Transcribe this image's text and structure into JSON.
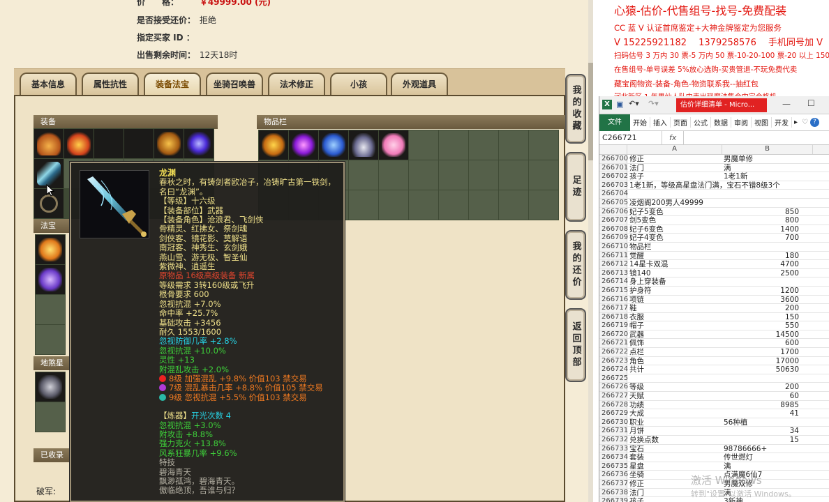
{
  "trade_info": {
    "price_label": "价　　格：",
    "price_value": "￥49999.00 (元)",
    "counter_label": "是否接受还价：",
    "counter_value": "拒绝",
    "buyer_label": "指定买家 ID ：",
    "buyer_value": "",
    "remain_label": "出售剩余时间：",
    "remain_value": "12天18时"
  },
  "tabs": [
    "基本信息",
    "属性抗性",
    "装备法宝",
    "坐骑召唤兽",
    "法术修正",
    "小孩",
    "外观道具"
  ],
  "active_tab": "装备法宝",
  "sections": {
    "equip": "装备",
    "inventory": "物品栏",
    "treasure": "法宝",
    "earth_treasure": "地煞星阵",
    "collected": "已收录",
    "break_label": "破军:"
  },
  "side_buttons": [
    "我的收藏",
    "足迹",
    "我的还价",
    "返回顶部"
  ],
  "tooltip": {
    "name": "龙渊",
    "desc": "春秋之时，有铸剑者欧冶子，冶铸旷古第一铁剑，名曰“龙渊”。",
    "level": "【等级】十六级",
    "slot": "【装备部位】武器",
    "roles": "【装备角色】沧浪君、飞剑侠",
    "roles2": "骨精灵、红拂女、祭剑魂",
    "roles3": "剑侠客、镜花影、莫解语",
    "roles4": "南冠客、神秀生、玄剑娥",
    "roles5": "燕山雪、游无极、智圣仙",
    "roles6": "紫微神、逍遥生",
    "origin": "原物品 16级高级装备 新属",
    "req_level": "等级需求 3转160级或飞升",
    "req_bone": "根骨要求 600",
    "attr1": "忽视抗混 +7.0%",
    "attr2": "命中率 +25.7%",
    "attr3": "基础攻击 +3456",
    "durability": "耐久 1553/1600",
    "attr4": "忽视防御几率 +2.8%",
    "attr5": "忽视抗混 +10.0%",
    "attr6": "灵性 +13",
    "attr7": "附混乱攻击 +2.0%",
    "gem1": "8级 加强混乱 +9.8% 价值103 禁交易",
    "gem2": "7级 混乱暴击几率 +8.8% 价值105 禁交易",
    "gem3": "9级 忽视抗混 +5.5% 价值103 禁交易",
    "refine_head": "【炼器】",
    "refine_count": "开光次数 4",
    "ref1": "忽视抗混 +3.0%",
    "ref2": "附攻击 +8.8%",
    "ref3": "强力克火 +13.8%",
    "ref4": "风系狂暴几率 +9.6%",
    "skill_head": "特技",
    "skill_name": "碧海青天",
    "skill_desc": "飘渺孤鸿，碧海青天。",
    "skill_desc2": "傲临绝顶，吾谁与归？"
  },
  "promo": {
    "line1": "心猿-估价-代售组号-找号-免费配装",
    "line2": "CC 蓝 V 认证首席鉴定+大神金牌鉴定为您服务",
    "line3": "V 15225921182 　1379258576 　手机同号加 V",
    "line4": "扫码估号 3 万内 30 票-5 万内 50 票-10-20-100 票-20 以上 150",
    "line5": "在售组号-单号误差 5%放心选购-买贵管退-不玩免费代卖",
    "line6": "藏宝阁物资-装备-角色-物资联系我--抽红包",
    "line7": "河北新区 1 年男仙人队中表出现魔法集合中宗合格机"
  },
  "excel": {
    "window_title": "估价详细清单 - Micro...",
    "file_tab": "文件",
    "menus": [
      "开始",
      "插入",
      "页面",
      "公式",
      "数据",
      "审阅",
      "视图",
      "开发"
    ],
    "name_box": "C266721",
    "fx": "fx",
    "col_a": "A",
    "col_b": "B",
    "rows": [
      {
        "n": "266700",
        "a": "修正",
        "b": "男魔单修",
        "t": "txt"
      },
      {
        "n": "266701",
        "a": "法门",
        "b": "满",
        "t": "txt"
      },
      {
        "n": "266702",
        "a": "孩子",
        "b": "1老1新",
        "t": "txt"
      },
      {
        "n": "266703",
        "a": "1老1新，等级高星盘法门满，宝石不错8级3个",
        "b": "",
        "t": "txt"
      },
      {
        "n": "266704",
        "a": "",
        "b": "",
        "t": "txt"
      },
      {
        "n": "266705",
        "a": "凌烟阁200男人49999",
        "b": "",
        "t": "txt"
      },
      {
        "n": "266706",
        "a": "妃子5变色",
        "b": "850",
        "t": "num"
      },
      {
        "n": "266707",
        "a": "剑5变色",
        "b": "800",
        "t": "num"
      },
      {
        "n": "266708",
        "a": "妃子6变色",
        "b": "1400",
        "t": "num"
      },
      {
        "n": "266709",
        "a": "妃子4变色",
        "b": "700",
        "t": "num"
      },
      {
        "n": "266710",
        "a": "物品栏",
        "b": "",
        "t": "txt"
      },
      {
        "n": "266711",
        "a": "觉醒",
        "b": "180",
        "t": "num"
      },
      {
        "n": "266712",
        "a": "14星卡双混",
        "b": "4700",
        "t": "num"
      },
      {
        "n": "266713",
        "a": "镜140",
        "b": "2500",
        "t": "num"
      },
      {
        "n": "266714",
        "a": "身上穿装备",
        "b": "",
        "t": "txt"
      },
      {
        "n": "266715",
        "a": "护身符",
        "b": "1200",
        "t": "num"
      },
      {
        "n": "266716",
        "a": "项链",
        "b": "3600",
        "t": "num"
      },
      {
        "n": "266717",
        "a": "鞋",
        "b": "200",
        "t": "num"
      },
      {
        "n": "266718",
        "a": "衣服",
        "b": "150",
        "t": "num"
      },
      {
        "n": "266719",
        "a": "帽子",
        "b": "550",
        "t": "num"
      },
      {
        "n": "266720",
        "a": "武器",
        "b": "14500",
        "t": "num"
      },
      {
        "n": "266721",
        "a": "佩饰",
        "b": "600",
        "t": "num"
      },
      {
        "n": "266722",
        "a": "点栏",
        "b": "1700",
        "t": "num"
      },
      {
        "n": "266723",
        "a": "角色",
        "b": "17000",
        "t": "num"
      },
      {
        "n": "266724",
        "a": "共计",
        "b": "50630",
        "t": "num"
      },
      {
        "n": "266725",
        "a": "",
        "b": "",
        "t": "txt"
      },
      {
        "n": "266726",
        "a": "等级",
        "b": "200",
        "t": "num"
      },
      {
        "n": "266727",
        "a": "天赋",
        "b": "60",
        "t": "num"
      },
      {
        "n": "266728",
        "a": "功绩",
        "b": "8985",
        "t": "num"
      },
      {
        "n": "266729",
        "a": "大成",
        "b": "41",
        "t": "num"
      },
      {
        "n": "266730",
        "a": "职业",
        "b": "56种植",
        "t": "txt"
      },
      {
        "n": "266731",
        "a": "月饼",
        "b": "34",
        "t": "num"
      },
      {
        "n": "266732",
        "a": "兑换点数",
        "b": "15",
        "t": "num"
      },
      {
        "n": "266733",
        "a": "宝石",
        "b": "98786666+",
        "t": "txt"
      },
      {
        "n": "266734",
        "a": "套装",
        "b": "传世燃灯",
        "t": "txt"
      },
      {
        "n": "266735",
        "a": "星盘",
        "b": "满",
        "t": "txt"
      },
      {
        "n": "266736",
        "a": "坐骑",
        "b": "点满魔6仙7",
        "t": "txt"
      },
      {
        "n": "266737",
        "a": "修正",
        "b": "男魔双修",
        "t": "txt"
      },
      {
        "n": "266738",
        "a": "法门",
        "b": "满",
        "t": "txt"
      },
      {
        "n": "266739",
        "a": "孩子",
        "b": "3新神",
        "t": "txt"
      }
    ]
  },
  "watermark": {
    "line1": "激活 Windows",
    "line2": "转到\"设置\"以激活 Windows。"
  }
}
